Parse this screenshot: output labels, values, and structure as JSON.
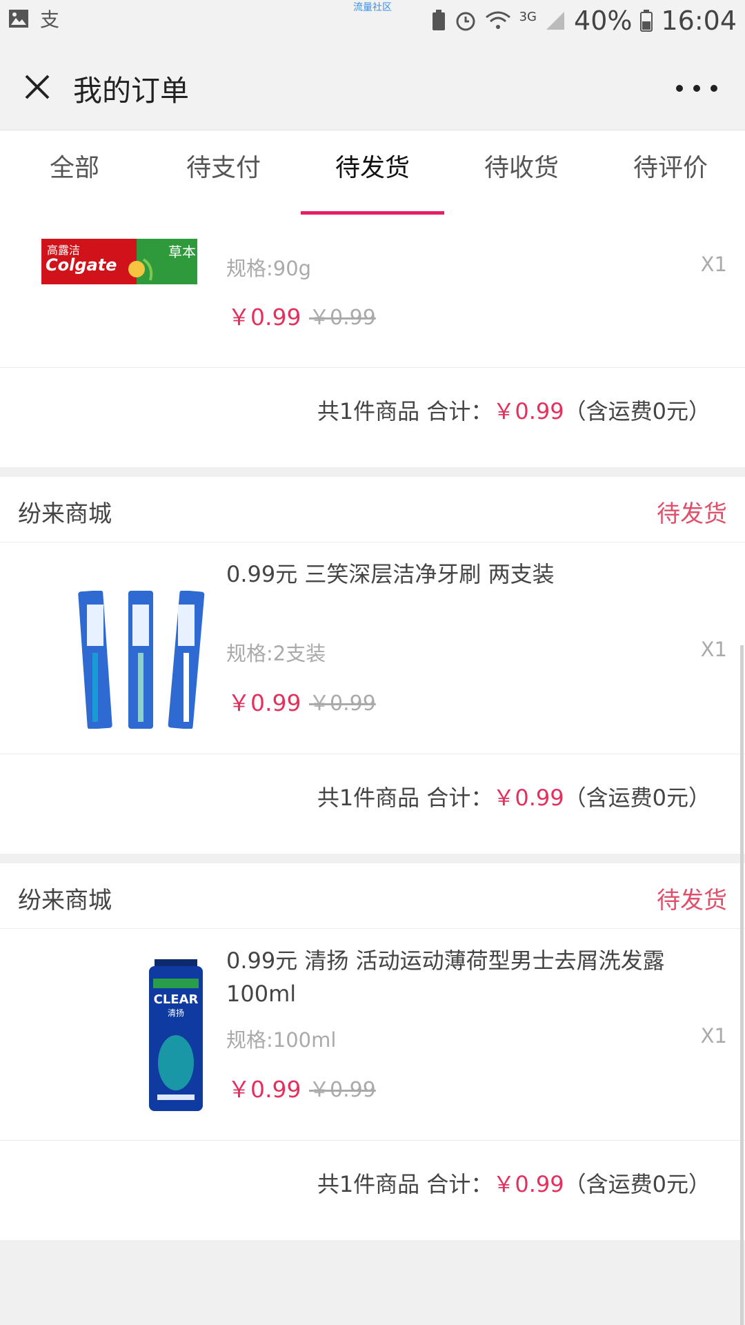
{
  "status_bar": {
    "carrier_label": "流量社区",
    "network": "3G",
    "battery": "40%",
    "time": "16:04"
  },
  "nav": {
    "title": "我的订单"
  },
  "tabs": [
    {
      "label": "全部",
      "active": false
    },
    {
      "label": "待支付",
      "active": false
    },
    {
      "label": "待发货",
      "active": true
    },
    {
      "label": "待收货",
      "active": false
    },
    {
      "label": "待评价",
      "active": false
    }
  ],
  "orders": [
    {
      "item": {
        "image": "colgate-toothpaste",
        "spec": "规格:90g",
        "qty": "X1",
        "price": "￥0.99",
        "original_price": "￥0.99"
      },
      "summary": {
        "prefix": "共1件商品 合计：",
        "total": "￥0.99",
        "suffix": "（含运费0元）"
      }
    },
    {
      "shop": "纷来商城",
      "status": "待发货",
      "item": {
        "image": "toothbrush-pack",
        "title": "0.99元 三笑深层洁净牙刷 两支装",
        "spec": "规格:2支装",
        "qty": "X1",
        "price": "￥0.99",
        "original_price": "￥0.99"
      },
      "summary": {
        "prefix": "共1件商品 合计：",
        "total": "￥0.99",
        "suffix": "（含运费0元）"
      }
    },
    {
      "shop": "纷来商城",
      "status": "待发货",
      "item": {
        "image": "clear-shampoo-bottle",
        "title": "0.99元 清扬 活动运动薄荷型男士去屑洗发露 100ml",
        "spec": "规格:100ml",
        "qty": "X1",
        "price": "￥0.99",
        "original_price": "￥0.99"
      },
      "summary": {
        "prefix": "共1件商品 合计：",
        "total": "￥0.99",
        "suffix": "（含运费0元）"
      }
    }
  ],
  "logos": {
    "colgate_brand": "Colgate",
    "colgate_cn": "高露洁",
    "colgate_variant": "草本",
    "clear_brand": "CLEAR",
    "clear_cn": "清扬"
  },
  "colors": {
    "accent": "#e51f65",
    "price": "#e5305d",
    "status": "#e0506a"
  }
}
